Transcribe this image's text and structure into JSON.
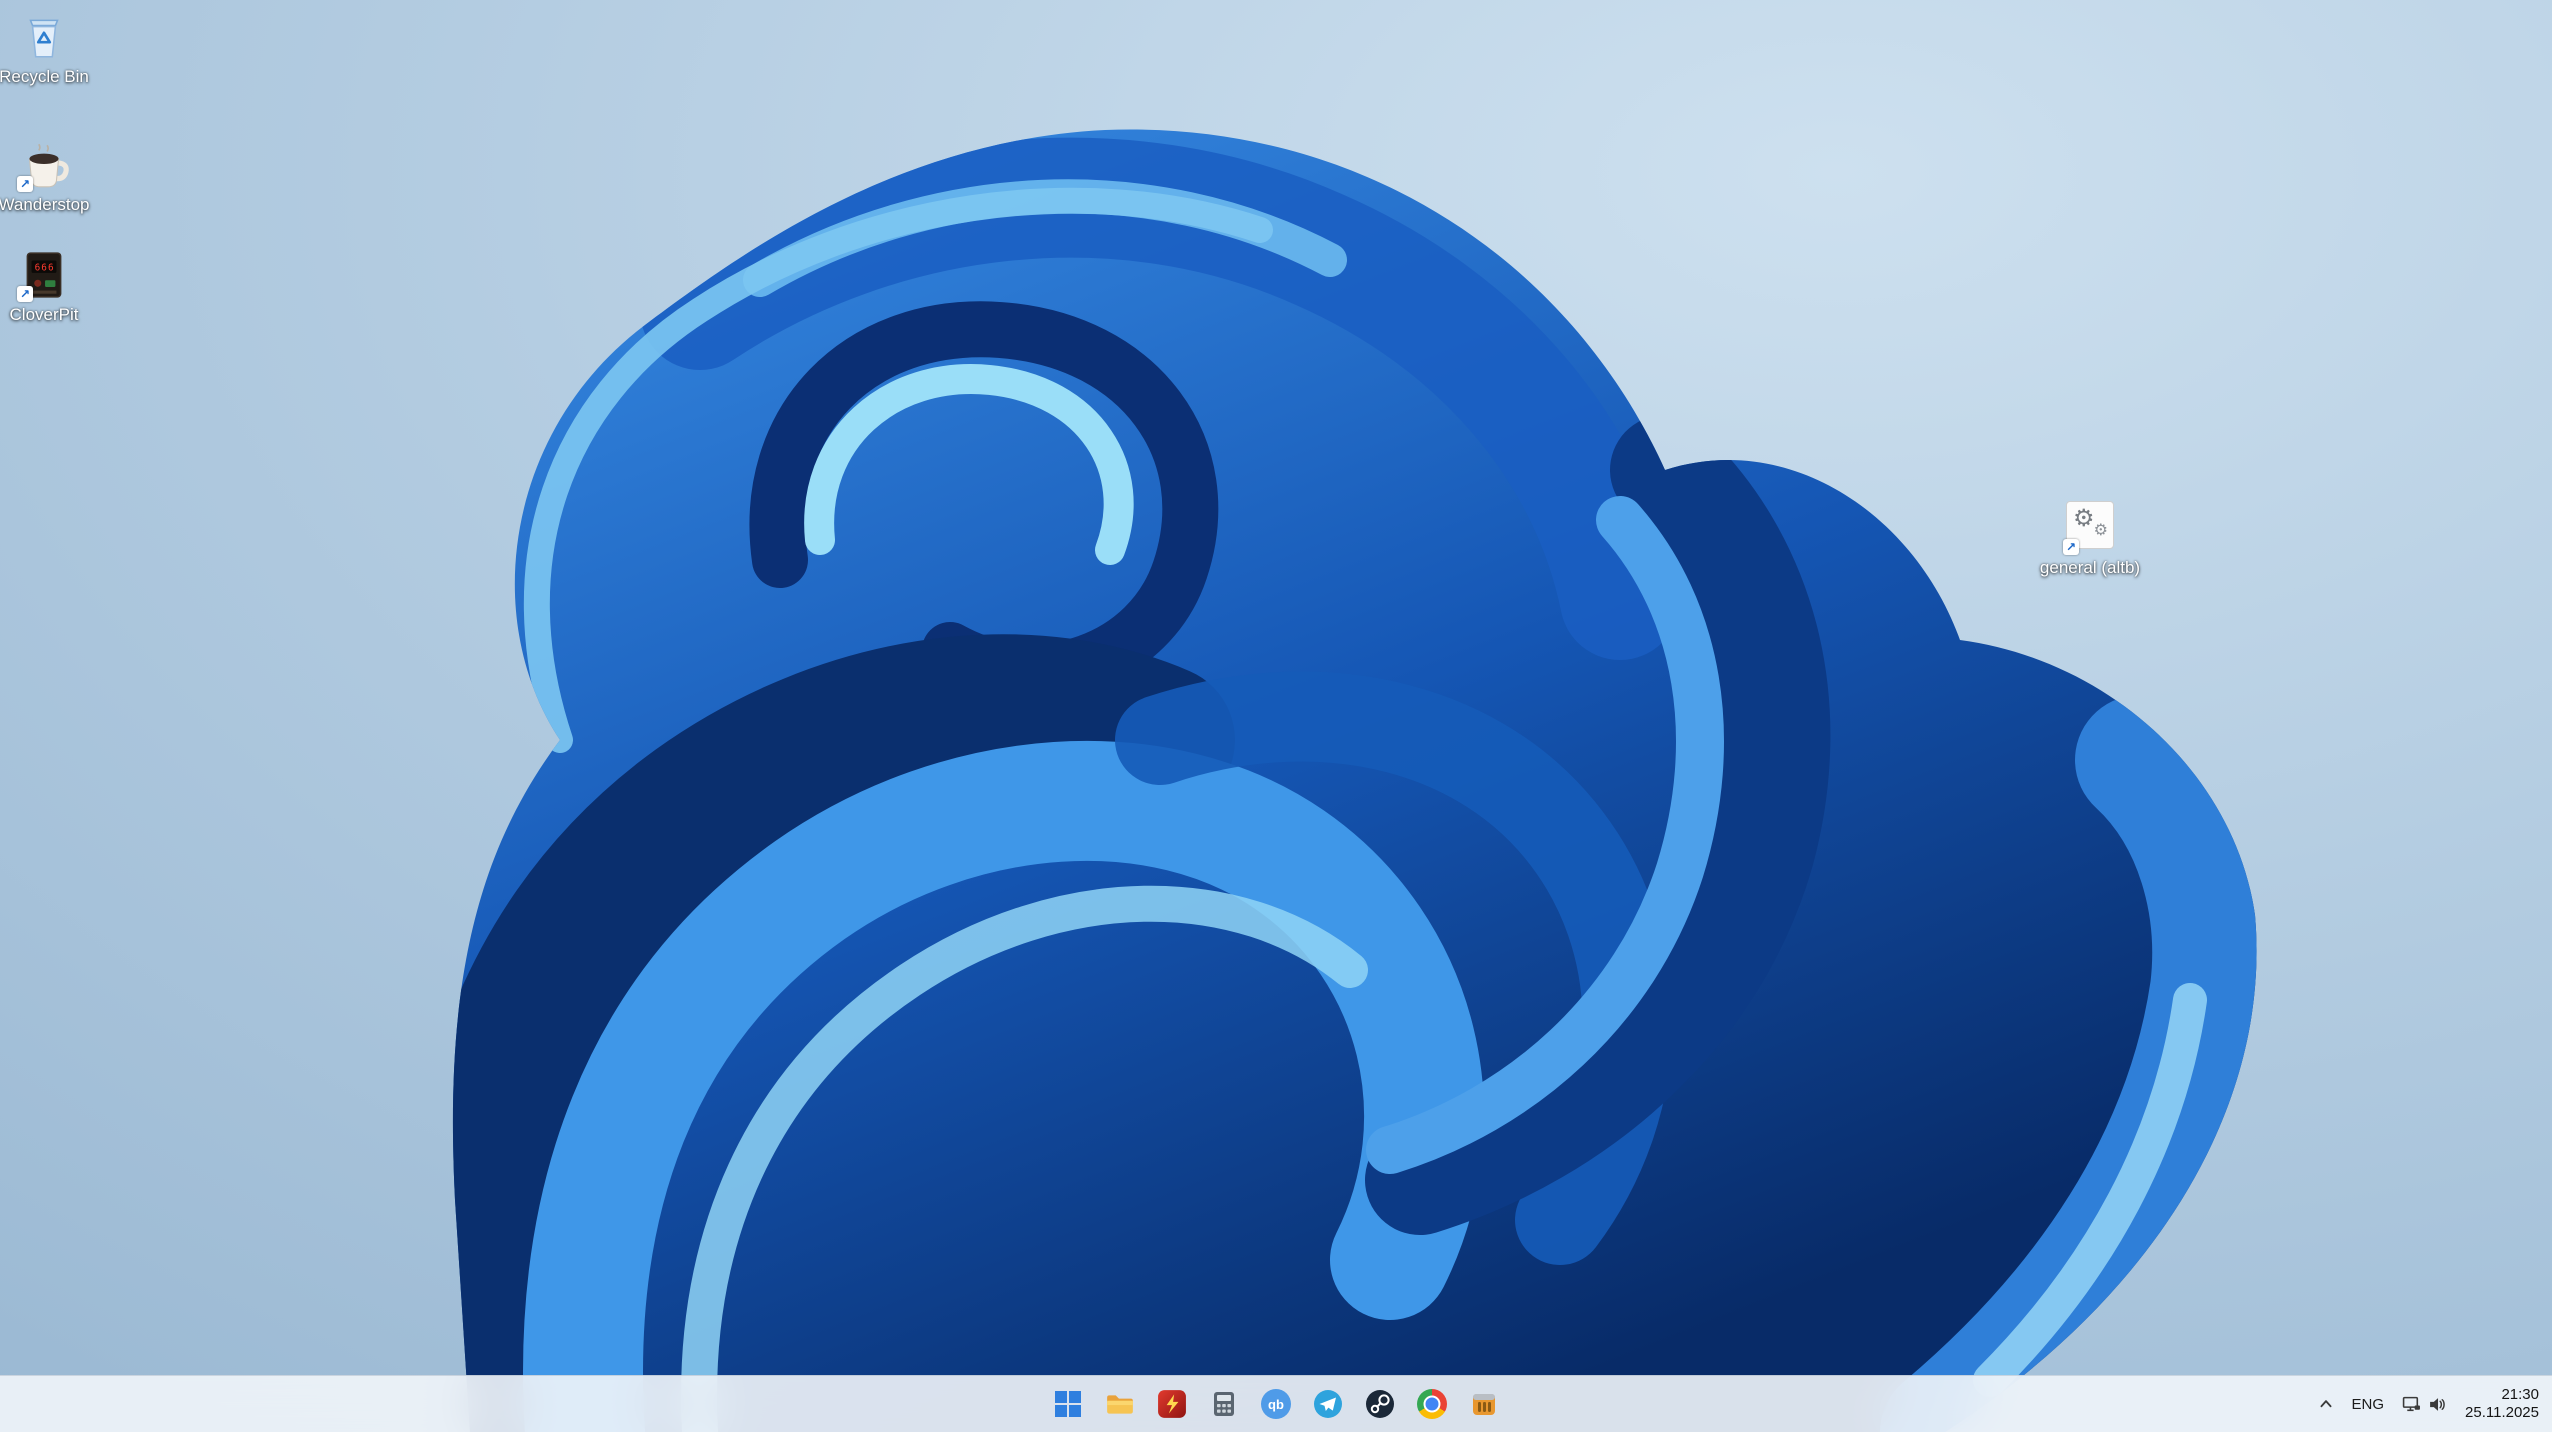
{
  "desktop": {
    "icons": [
      {
        "label": "Recycle Bin"
      },
      {
        "label": "Wanderstop"
      },
      {
        "label": "CloverPit"
      },
      {
        "label": "general (altb)"
      }
    ],
    "cloverpit_display": "666",
    "shortcut_arrow": "↗",
    "gear_glyph": "⚙"
  },
  "wallpaper": {
    "theme": "windows-11-bloom",
    "colors": {
      "background_light": "#cde0ef",
      "background_dark": "#93b3cf",
      "bloom_light": "#8fd4f6",
      "bloom_mid": "#2f86e2",
      "bloom_dark": "#0a2f6e"
    }
  },
  "taskbar": {
    "apps": [
      {
        "name": "start"
      },
      {
        "name": "file-explorer"
      },
      {
        "name": "red-game"
      },
      {
        "name": "calculator"
      },
      {
        "name": "qbittorrent",
        "label": "qb"
      },
      {
        "name": "telegram"
      },
      {
        "name": "steam"
      },
      {
        "name": "chrome"
      },
      {
        "name": "orange-game"
      }
    ],
    "tray": {
      "language": "ENG",
      "time": "21:30",
      "date": "25.11.2025"
    }
  }
}
